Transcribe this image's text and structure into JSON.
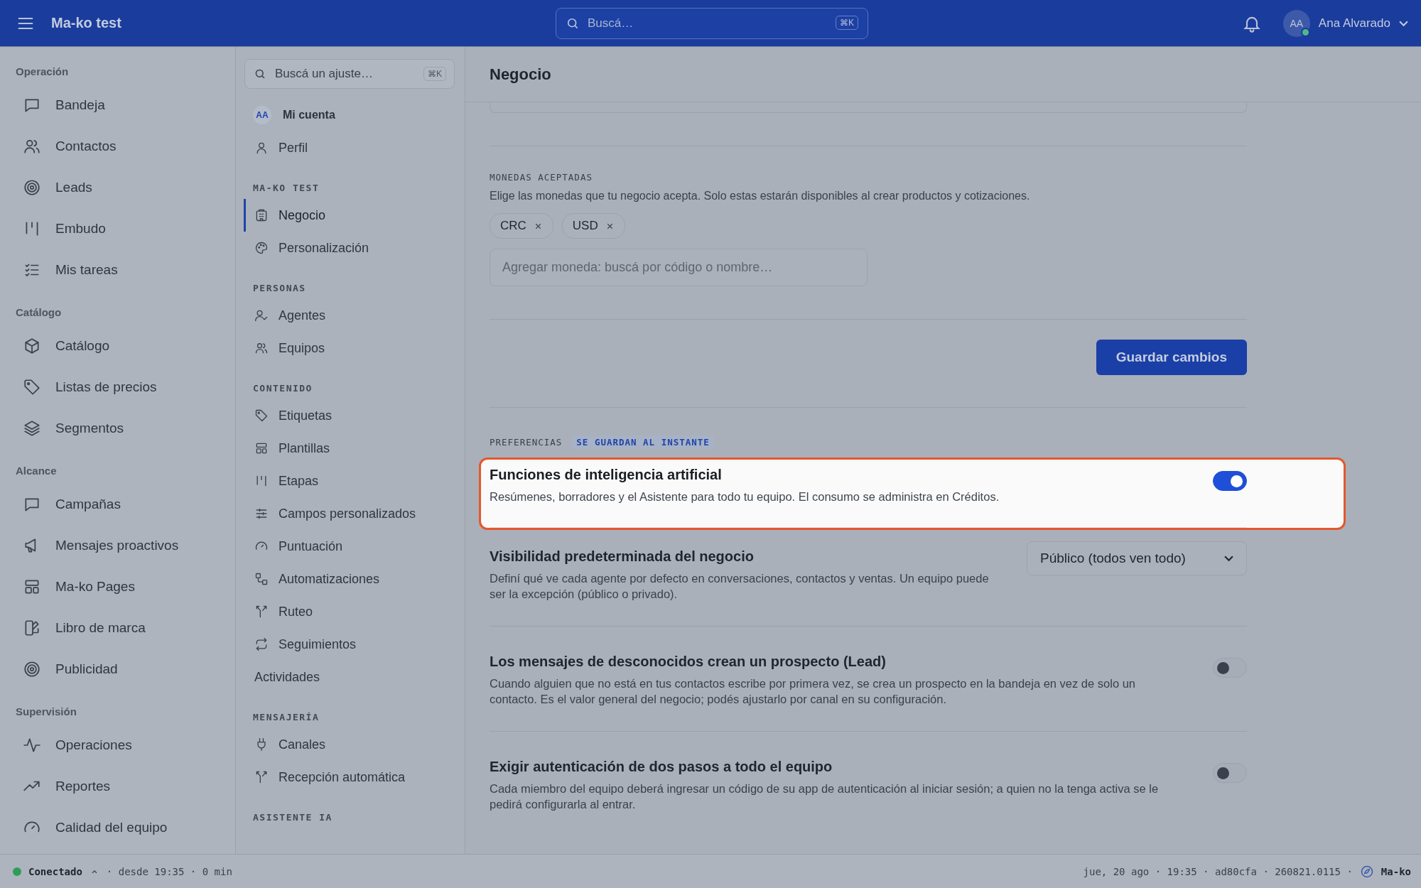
{
  "topbar": {
    "app_name": "Ma-ko test",
    "search": {
      "placeholder": "Buscá…",
      "shortcut": "⌘K"
    },
    "user": {
      "initials": "AA",
      "name": "Ana Alvarado",
      "online": true
    }
  },
  "sidebar": {
    "sections": [
      {
        "title": "Operación",
        "items": [
          {
            "label": "Bandeja",
            "selected": false
          },
          {
            "label": "Contactos",
            "selected": false
          },
          {
            "label": "Leads",
            "selected": false
          },
          {
            "label": "Embudo",
            "selected": false
          },
          {
            "label": "Mis tareas",
            "selected": false
          }
        ]
      },
      {
        "title": "Catálogo",
        "items": [
          {
            "label": "Catálogo",
            "selected": false
          },
          {
            "label": "Listas de precios",
            "selected": false
          },
          {
            "label": "Segmentos",
            "selected": false
          }
        ]
      },
      {
        "title": "Alcance",
        "items": [
          {
            "label": "Campañas",
            "selected": false
          },
          {
            "label": "Mensajes proactivos",
            "selected": false
          },
          {
            "label": "Ma-ko Pages",
            "selected": false
          },
          {
            "label": "Libro de marca",
            "selected": false
          },
          {
            "label": "Publicidad",
            "selected": false
          }
        ]
      },
      {
        "title": "Supervisión",
        "items": [
          {
            "label": "Operaciones",
            "selected": false
          },
          {
            "label": "Reportes",
            "selected": false
          },
          {
            "label": "Calidad del equipo",
            "selected": false
          }
        ]
      }
    ]
  },
  "settings_nav": {
    "search": {
      "placeholder": "Buscá un ajuste…",
      "shortcut": "⌘K"
    },
    "account": {
      "initials": "AA",
      "label": "Mi cuenta",
      "items": [
        {
          "label": "Perfil",
          "selected": false,
          "icon": true
        }
      ]
    },
    "sections": [
      {
        "title": "MA-KO TEST",
        "items": [
          {
            "label": "Negocio",
            "selected": true,
            "icon": true
          },
          {
            "label": "Personalización",
            "selected": false,
            "icon": true
          }
        ]
      },
      {
        "title": "PERSONAS",
        "items": [
          {
            "label": "Agentes",
            "selected": false,
            "icon": true
          },
          {
            "label": "Equipos",
            "selected": false,
            "icon": true
          }
        ]
      },
      {
        "title": "CONTENIDO",
        "items": [
          {
            "label": "Etiquetas",
            "selected": false,
            "icon": true
          },
          {
            "label": "Plantillas",
            "selected": false,
            "icon": true
          },
          {
            "label": "Etapas",
            "selected": false,
            "icon": true
          },
          {
            "label": "Campos personalizados",
            "selected": false,
            "icon": true
          },
          {
            "label": "Puntuación",
            "selected": false,
            "icon": true
          },
          {
            "label": "Automatizaciones",
            "selected": false,
            "icon": true
          },
          {
            "label": "Ruteo",
            "selected": false,
            "icon": true
          },
          {
            "label": "Seguimientos",
            "selected": false,
            "icon": true
          },
          {
            "label": "Actividades",
            "selected": false,
            "icon": false
          }
        ]
      },
      {
        "title": "MENSAJERÍA",
        "items": [
          {
            "label": "Canales",
            "selected": false,
            "icon": true
          },
          {
            "label": "Recepción automática",
            "selected": false,
            "icon": true
          }
        ]
      },
      {
        "title": "ASISTENTE IA"
      }
    ]
  },
  "page": {
    "title": "Negocio",
    "currencies": {
      "title": "MONEDAS ACEPTADAS",
      "description": "Elige las monedas que tu negocio acepta. Solo estas estarán disponibles al crear productos y cotizaciones.",
      "chips": [
        "CRC",
        "USD"
      ],
      "input": {
        "placeholder": "Agregar moneda: buscá por código o nombre…"
      }
    },
    "save_button": "Guardar cambios",
    "preferences": {
      "title": "PREFERENCIAS",
      "badge": "SE GUARDAN AL INSTANTE",
      "rows": [
        {
          "kind": "toggle",
          "title": "Funciones de inteligencia artificial",
          "description": "Resúmenes, borradores y el Asistente para todo tu equipo. El consumo se administra en Créditos.",
          "on": true,
          "highlighted": true
        },
        {
          "kind": "select",
          "title": "Visibilidad predeterminada del negocio",
          "description": "Definí qué ve cada agente por defecto en conversaciones, contactos y ventas. Un equipo puede ser la excepción (público o privado).",
          "value": "Público (todos ven todo)",
          "highlighted": false
        },
        {
          "kind": "toggle",
          "title": "Los mensajes de desconocidos crean un prospecto (Lead)",
          "description": "Cuando alguien que no está en tus contactos escribe por primera vez, se crea un prospecto en la bandeja en vez de solo un contacto. Es el valor general del negocio; podés ajustarlo por canal en su configuración.",
          "on": false,
          "highlighted": false
        },
        {
          "kind": "toggle",
          "title": "Exigir autenticación de dos pasos a todo el equipo",
          "description": "Cada miembro del equipo deberá ingresar un código de su app de autenticación al iniciar sesión; a quien no la tenga activa se le pedirá configurarla al entrar.",
          "on": false,
          "highlighted": false
        }
      ]
    }
  },
  "status_bar": {
    "connected": true,
    "status": "Conectado",
    "since": "· desde 19:35 · 0 min",
    "build": "jue, 20 ago · 19:35 · ad80cfa · 260821.0115 ·",
    "brand": "Ma-ko"
  }
}
